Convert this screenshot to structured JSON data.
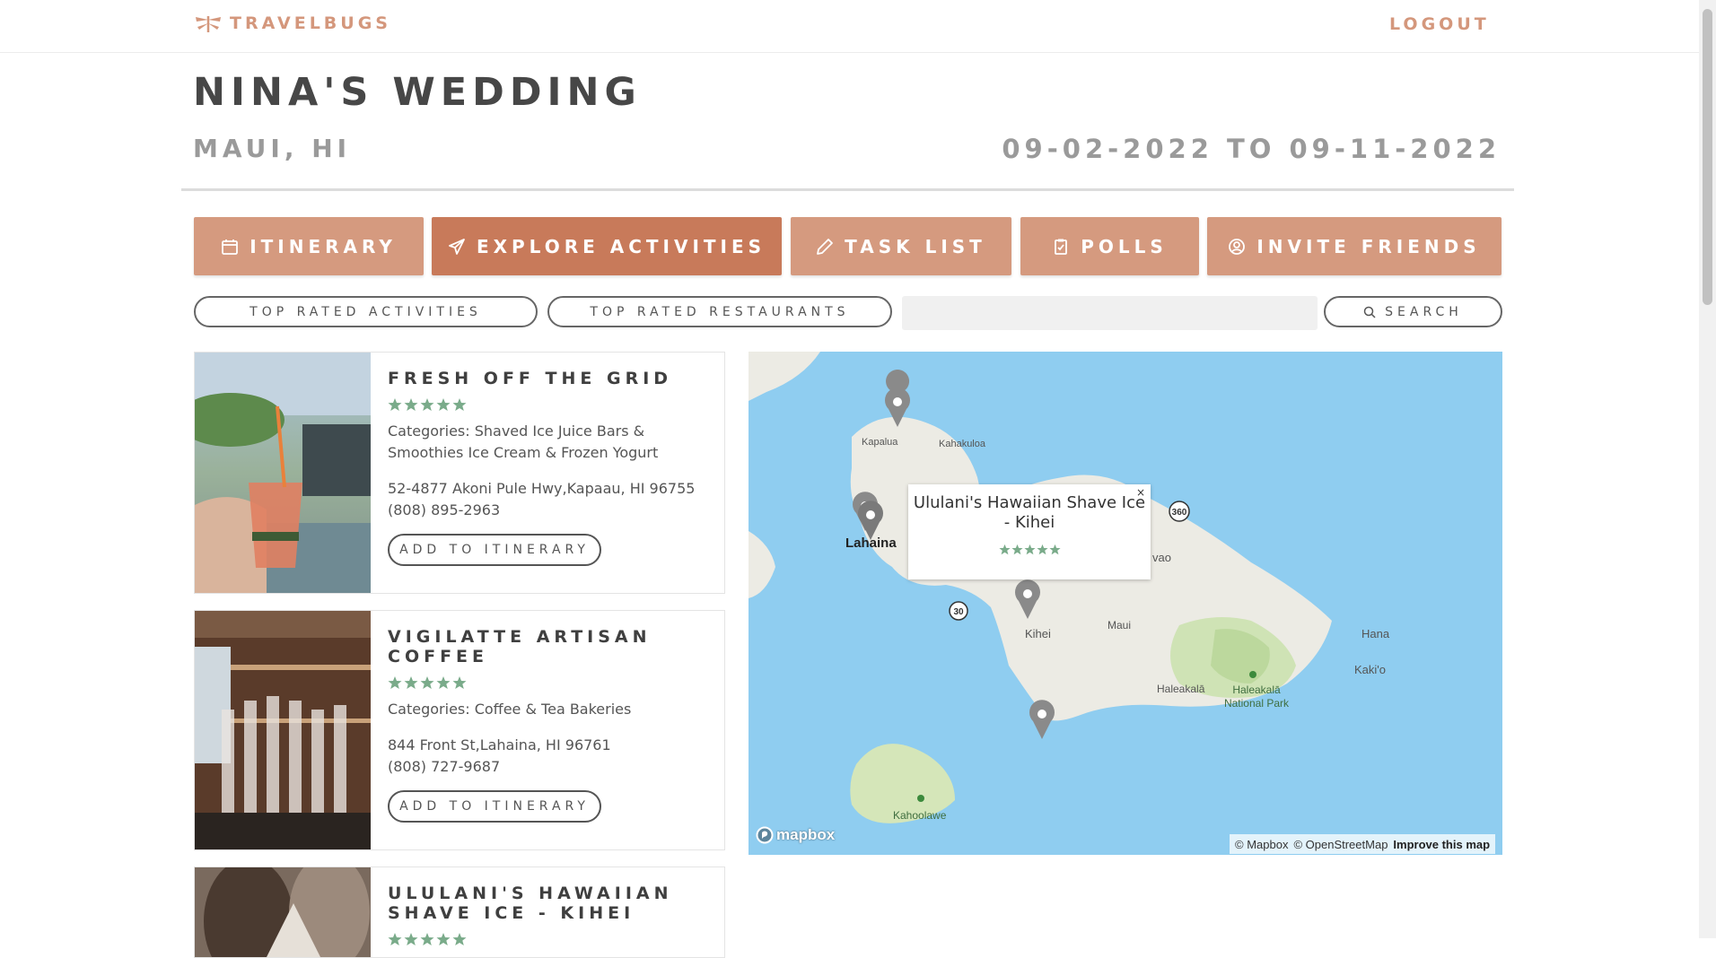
{
  "nav": {
    "brand": "TRAVELBUGS",
    "logout": "LOGOUT"
  },
  "trip": {
    "title": "NINA'S WEDDING",
    "location": "MAUI, HI",
    "dates": "09-02-2022 TO 09-11-2022"
  },
  "tabs": [
    {
      "label": "ITINERARY",
      "icon": "calendar-icon"
    },
    {
      "label": "EXPLORE ACTIVITIES",
      "icon": "paper-plane-icon",
      "active": true
    },
    {
      "label": "TASK LIST",
      "icon": "pencil-icon"
    },
    {
      "label": "POLLS",
      "icon": "clipboard-check-icon"
    },
    {
      "label": "INVITE FRIENDS",
      "icon": "user-circle-icon"
    }
  ],
  "filters": {
    "top_activities": "TOP RATED ACTIVITIES",
    "top_restaurants": "TOP RATED RESTAURANTS",
    "search_value": "",
    "search_label": "SEARCH"
  },
  "results": [
    {
      "name": "FRESH OFF THE GRID",
      "rating": 5,
      "categories": "Categories: Shaved Ice Juice Bars & Smoothies Ice Cream & Frozen Yogurt",
      "address": "52-4877 Akoni Pule Hwy,Kapaau, HI 96755",
      "phone": "(808) 895-2963",
      "button": "ADD TO ITINERARY"
    },
    {
      "name": "VIGILATTE ARTISAN COFFEE",
      "rating": 5,
      "categories": "Categories: Coffee & Tea Bakeries",
      "address": "844 Front St,Lahaina, HI 96761",
      "phone": "(808) 727-9687",
      "button": "ADD TO ITINERARY"
    },
    {
      "name": "ULULANI'S HAWAIIAN SHAVE ICE - KIHEI",
      "rating": 5
    }
  ],
  "map": {
    "popup": {
      "title": "Ululani's Hawaiian Shave Ice - Kihei",
      "rating": 5,
      "close": "×"
    },
    "labels": {
      "kapalua": "Kapalua",
      "kahakuloa": "Kahakuloa",
      "lahaina": "Lahaina",
      "wailuku": "vao",
      "kihei": "Kihei",
      "maui": "Maui",
      "hana": "Hana",
      "kaupo": "Kaki'o",
      "haleakala": "Haleakalā",
      "park": "Haleakalā National Park",
      "kahoolawe": "Kahoolawe",
      "route30": "30",
      "route360": "360"
    },
    "logo": "mapbox",
    "attribution": {
      "mapbox": "© Mapbox",
      "osm": "© OpenStreetMap",
      "improve": "Improve this map"
    }
  },
  "colors": {
    "accent": "#d59a7f",
    "accent_active": "#c87a5a",
    "star": "#7aab8a",
    "water": "#8fcdf0",
    "land": "#ecebe4"
  }
}
